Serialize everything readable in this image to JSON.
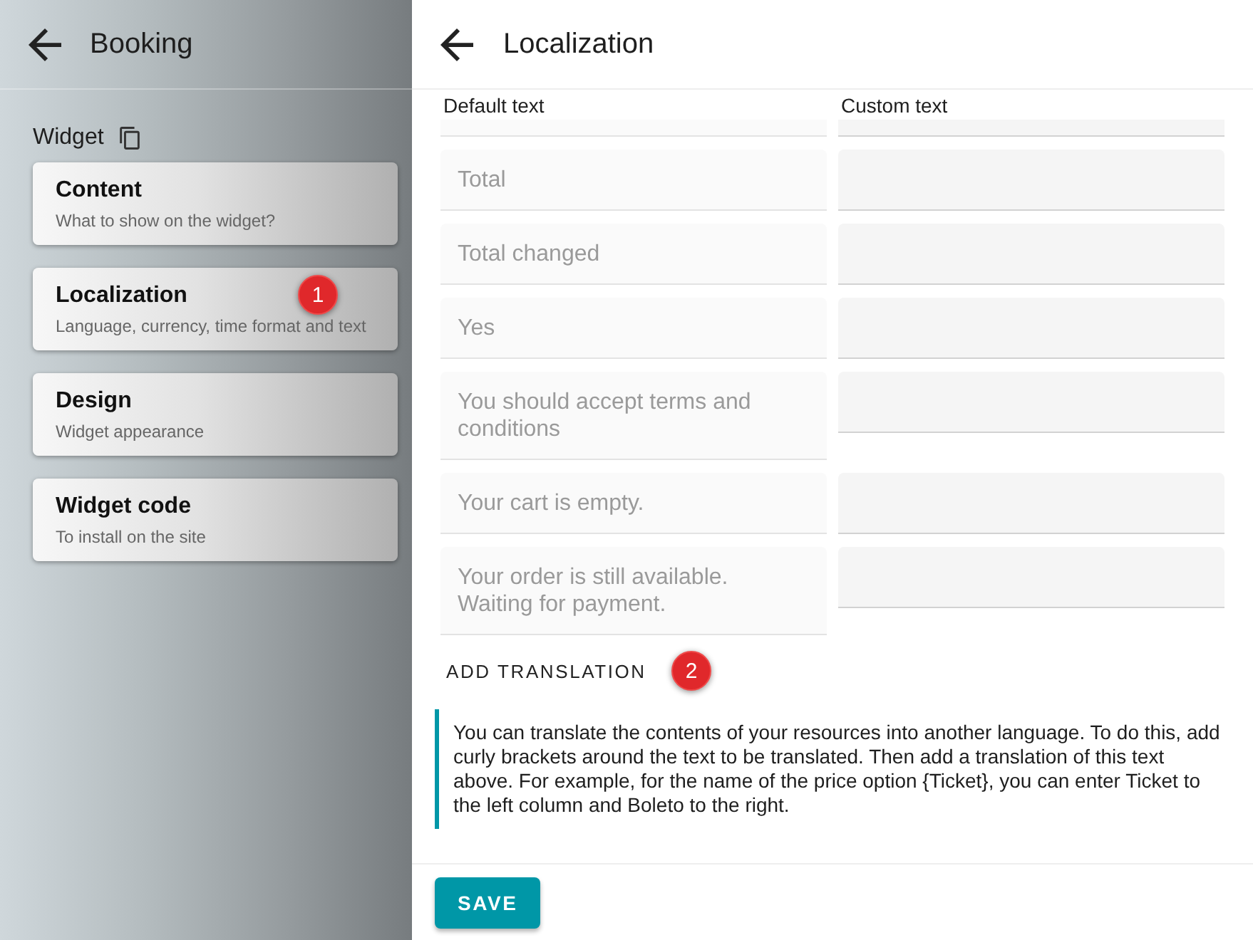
{
  "sidebar": {
    "title": "Booking",
    "section_label": "Widget",
    "items": [
      {
        "title": "Content",
        "subtitle": "What to show on the widget?"
      },
      {
        "title": "Localization",
        "subtitle": "Language, currency, time format and text",
        "marker": "1"
      },
      {
        "title": "Design",
        "subtitle": "Widget appearance"
      },
      {
        "title": "Widget code",
        "subtitle": "To install on the site"
      }
    ]
  },
  "main": {
    "title": "Localization",
    "columns": [
      "Default text",
      "Custom text"
    ],
    "rows": [
      {
        "kind": "clipped"
      },
      {
        "kind": "full",
        "default_text": "Total"
      },
      {
        "kind": "full",
        "default_text": "Total changed"
      },
      {
        "kind": "full",
        "default_text": "Yes"
      },
      {
        "kind": "full",
        "default_text": "You should accept terms and conditions"
      },
      {
        "kind": "full",
        "default_text": "Your cart is empty."
      },
      {
        "kind": "full",
        "default_text": "Your order is still available. Waiting for payment."
      }
    ],
    "add_translation": {
      "label": "ADD TRANSLATION",
      "marker": "2"
    },
    "info_text": "You can translate the contents of your resources into another language. To do this, add curly brackets around the text to be translated. Then add a translation of this text above. For example, for the name of the price option {Ticket}, you can enter Ticket to the left column and Boleto to the right.",
    "save_button": "SAVE"
  }
}
